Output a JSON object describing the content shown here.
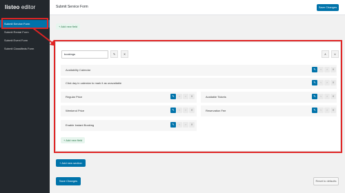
{
  "brand": {
    "name_bold": "listeo",
    "name_light": " editor"
  },
  "sidebar": {
    "items": [
      {
        "label": "Submit Service Form",
        "active": true
      },
      {
        "label": "Submit Rental Form",
        "active": false
      },
      {
        "label": "Submit Event Form",
        "active": false
      },
      {
        "label": "Submit Classifieds Form",
        "active": false
      }
    ]
  },
  "header": {
    "title": "Submit Service Form",
    "save_label": "Save Changes"
  },
  "top_add_field": "+ Add new field",
  "section": {
    "name_value": "bookings",
    "fields": [
      {
        "label": "Availability Calendar"
      },
      {
        "label": "Click day in calendar to mark it as unavailable"
      },
      {
        "label": "Regular Price"
      },
      {
        "label": "Available Tickets"
      },
      {
        "label": "Weekend Price"
      },
      {
        "label": "Reservation Fee"
      },
      {
        "label": "Enable Instant Booking"
      }
    ],
    "add_field_label": "+ Add new field"
  },
  "add_section_label": "+ Add new section",
  "footer": {
    "save_label": "Save Changes",
    "reset_label": "Reset to defaults"
  },
  "colors": {
    "accent": "#0073aa",
    "highlight": "#e02424"
  }
}
